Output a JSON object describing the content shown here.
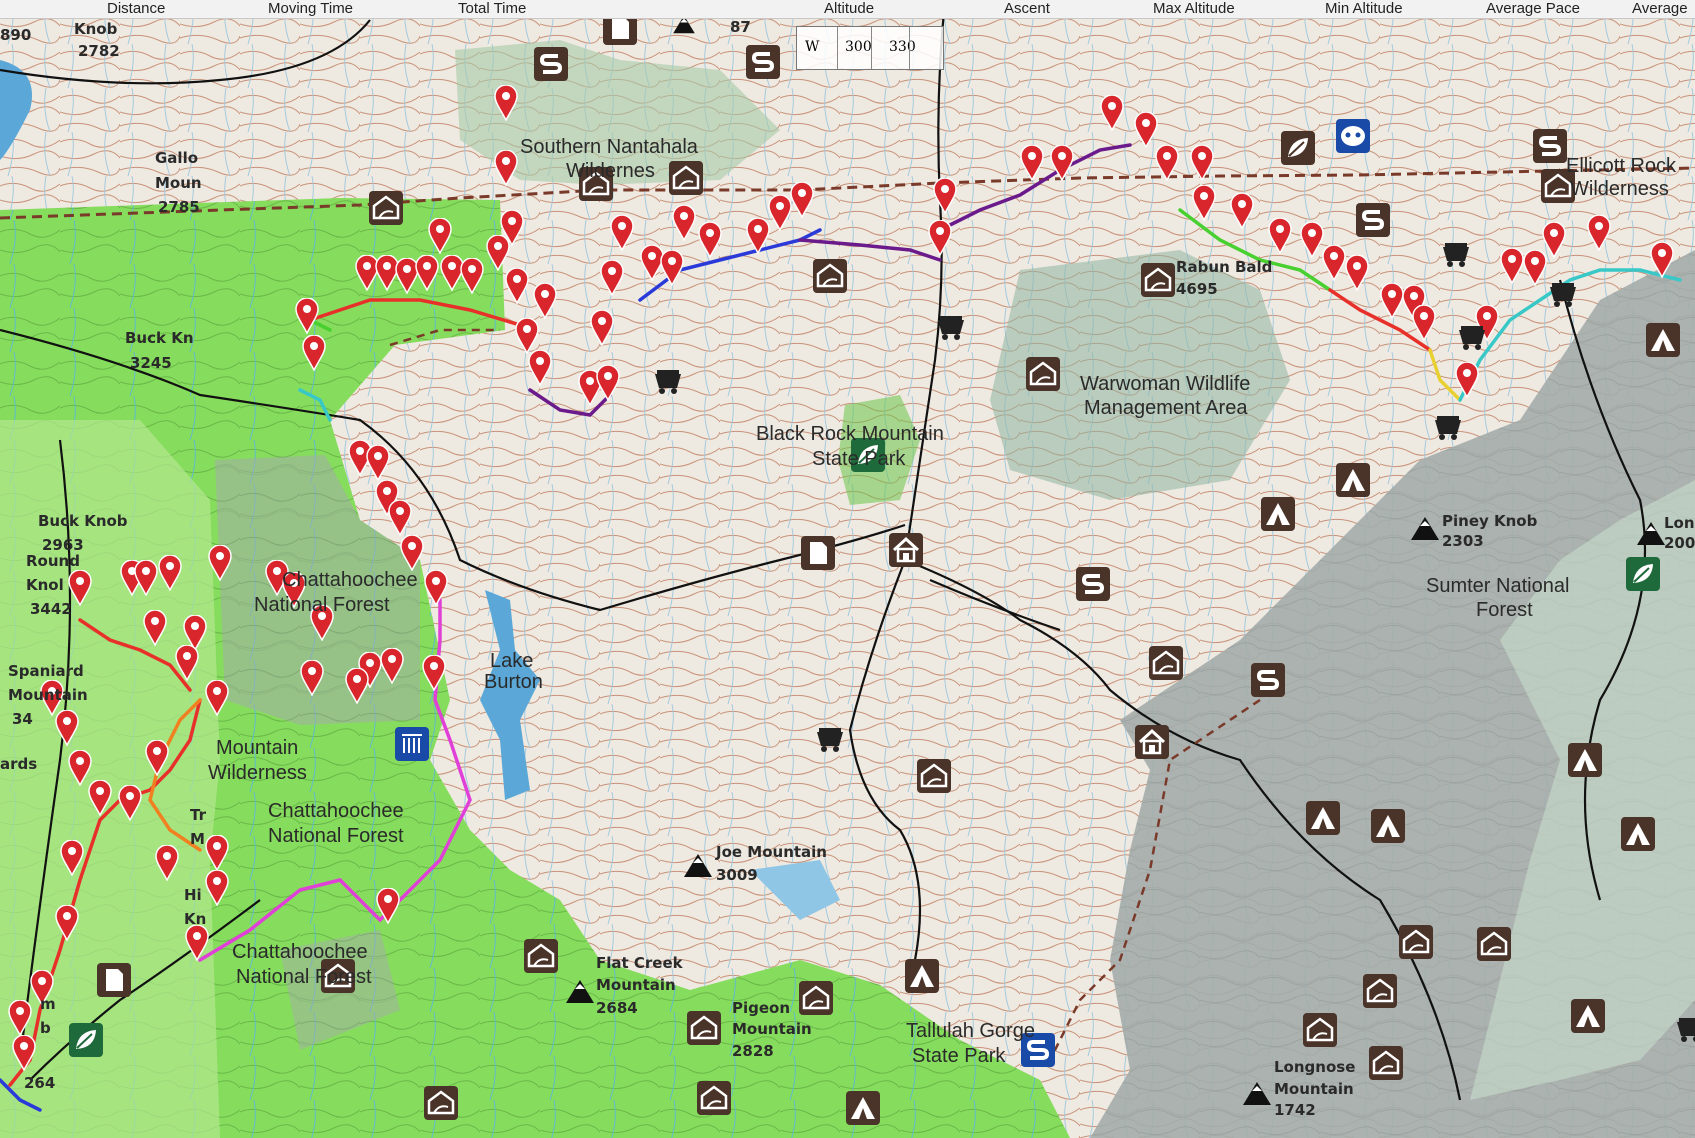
{
  "stats_bar": {
    "labels": [
      "Distance",
      "Moving Time",
      "Total Time",
      "Altitude",
      "Ascent",
      "Max Altitude",
      "Min Altitude",
      "Average Pace",
      "Average"
    ]
  },
  "compass": {
    "heading": "W",
    "tick_a": "300",
    "tick_b": "330"
  },
  "map": {
    "top_partial": {
      "left_value": "890",
      "top_peak_value": "87"
    },
    "peaks": [
      {
        "name": "Knob",
        "elev": "2782"
      },
      {
        "name": "Gallo",
        "name2": "Moun",
        "elev": "2785"
      },
      {
        "name": "Buck Kn",
        "elev": "3245"
      },
      {
        "name": "Buck Knob",
        "elev": "2963"
      },
      {
        "name": "Round",
        "name2": "Knol",
        "elev": "3442"
      },
      {
        "name": "Spaniard",
        "name2": "Mountain",
        "elev": "34"
      },
      {
        "name": "Rabun Bald",
        "elev": "4695"
      },
      {
        "name": "Piney Knob",
        "elev": "2303"
      },
      {
        "name": "Lon",
        "elev": "200"
      },
      {
        "name": "Joe Mountain",
        "elev": "3009"
      },
      {
        "name": "Flat Creek",
        "name2": "Mountain",
        "elev": "2684"
      },
      {
        "name": "Pigeon",
        "name2": "Mountain",
        "elev": "2828"
      },
      {
        "name": "Longnose",
        "name2": "Mountain",
        "elev": "1742"
      },
      {
        "name": "Tr",
        "name2": "M"
      },
      {
        "name": "Hi",
        "name2": "Kn"
      },
      {
        "name": "m",
        "name2": "b",
        "elev": "264"
      },
      {
        "name": "ards"
      }
    ],
    "areas": [
      {
        "line1": "Southern Nantahala",
        "line2": "Wildernes"
      },
      {
        "line1": "Ellicott Rock",
        "line2": "Wilderness"
      },
      {
        "line1": "Warwoman Wildlife",
        "line2": "Management Area"
      },
      {
        "line1": "Black Rock Mountain",
        "line2": "State Park"
      },
      {
        "line1": "Sumter National",
        "line2": "Forest"
      },
      {
        "line1": "Lake",
        "line2": "Burton"
      },
      {
        "line1": "Chattahoochee",
        "line2": "National Forest"
      },
      {
        "line1": "Chattahoochee",
        "line2": "National Forest"
      },
      {
        "line1": "Chattahoochee",
        "line2": "National Forest"
      },
      {
        "line1": "Mountain",
        "line2": "Wilderness"
      },
      {
        "line1": "Tallulah Gorge",
        "line2": "State Park"
      }
    ],
    "colors": {
      "forest_green": "#7ed957",
      "park_green": "#a8d8a0",
      "dark_forest": "#6a9a7a",
      "gray_forest": "#9aa6a2",
      "water": "#5ba8d8",
      "marker_red": "#d8262c",
      "icon_brown": "#4a3328",
      "trail_magenta": "#e040d8",
      "trail_red": "#e8302a",
      "trail_blue": "#2a3ad8",
      "trail_purple": "#6a1a8a",
      "trail_green": "#48d030",
      "trail_cyan": "#38c8c8",
      "trail_orange": "#f08020"
    }
  }
}
